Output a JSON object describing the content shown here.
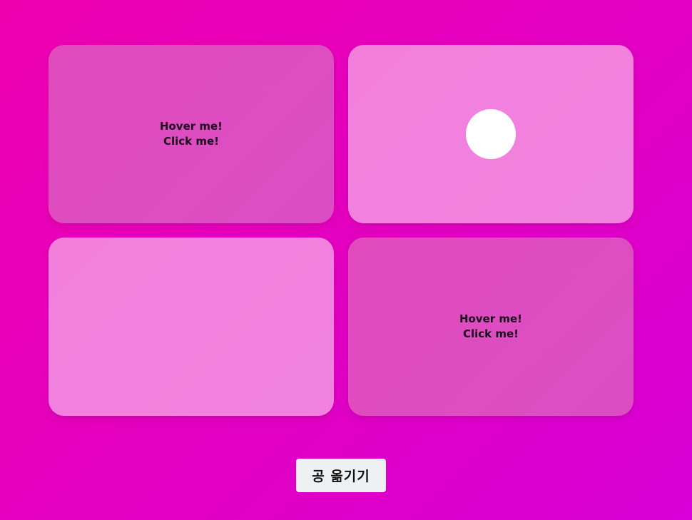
{
  "cards": [
    {
      "state": "dark",
      "line1": "Hover me!",
      "line2": "Click me!",
      "has_ball": false
    },
    {
      "state": "light",
      "line1": "",
      "line2": "",
      "has_ball": true
    },
    {
      "state": "light",
      "line1": "",
      "line2": "",
      "has_ball": false
    },
    {
      "state": "dark",
      "line1": "Hover me!",
      "line2": "Click me!",
      "has_ball": false
    }
  ],
  "ball": {
    "color": "#ffffff",
    "icon": "ball-circle"
  },
  "move_button": {
    "label": "공 옮기기"
  },
  "colors": {
    "background": "#e600c0",
    "card_dark": "#de4cc1",
    "card_light": "#f280de",
    "button_bg": "#eff0f1"
  }
}
